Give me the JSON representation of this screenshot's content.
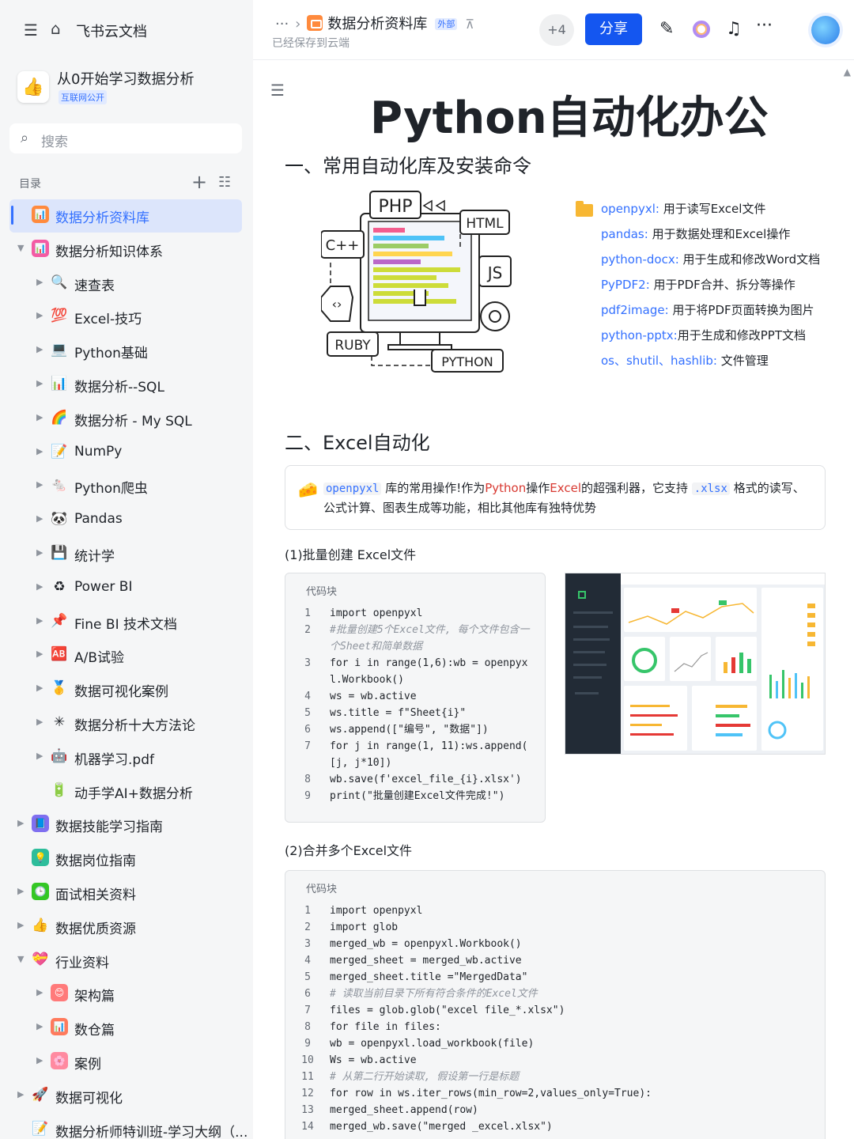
{
  "sidebar": {
    "app_name": "飞书云文档",
    "space": {
      "name": "从0开始学习数据分析",
      "badge": "互联网公开"
    },
    "search_placeholder": "搜索",
    "toc_label": "目录",
    "items": [
      {
        "label": "数据分析资料库",
        "level": 0,
        "icon": "📊",
        "icon_color": "#ff8a3d",
        "arrow": "",
        "selected": true
      },
      {
        "label": "数据分析知识体系",
        "level": 0,
        "icon": "📊",
        "icon_color": "#f45ba4",
        "arrow": "▼"
      },
      {
        "label": "速查表",
        "level": 1,
        "icon": "🔍",
        "arrow": "▶"
      },
      {
        "label": "Excel-技巧",
        "level": 1,
        "icon": "💯",
        "arrow": "▶"
      },
      {
        "label": "Python基础",
        "level": 1,
        "icon": "💻",
        "arrow": "▶"
      },
      {
        "label": "数据分析--SQL",
        "level": 1,
        "icon": "📊",
        "arrow": "▶"
      },
      {
        "label": "数据分析 - My SQL",
        "level": 1,
        "icon": "🌈",
        "arrow": "▶"
      },
      {
        "label": "NumPy",
        "level": 1,
        "icon": "📝",
        "arrow": "▶"
      },
      {
        "label": "Python爬虫",
        "level": 1,
        "icon": "🐁",
        "arrow": "▶"
      },
      {
        "label": "Pandas",
        "level": 1,
        "icon": "🐼",
        "arrow": "▶"
      },
      {
        "label": "统计学",
        "level": 1,
        "icon": "💾",
        "arrow": "▶"
      },
      {
        "label": "Power BI",
        "level": 1,
        "icon": "♻",
        "arrow": "▶"
      },
      {
        "label": "Fine BI 技术文档",
        "level": 1,
        "icon": "📌",
        "arrow": "▶"
      },
      {
        "label": "A/B试验",
        "level": 1,
        "icon": "🆎",
        "arrow": "▶"
      },
      {
        "label": "数据可视化案例",
        "level": 1,
        "icon": "🥇",
        "arrow": "▶"
      },
      {
        "label": "数据分析十大方法论",
        "level": 1,
        "icon": "✳",
        "arrow": "▶"
      },
      {
        "label": "机器学习.pdf",
        "level": 1,
        "icon": "🤖",
        "arrow": "▶"
      },
      {
        "label": "动手学AI+数据分析",
        "level": 1,
        "icon": "🔋",
        "arrow": ""
      },
      {
        "label": "数据技能学习指南",
        "level": 0,
        "icon": "📘",
        "icon_color": "#7f6ff0",
        "arrow": "▶"
      },
      {
        "label": "数据岗位指南",
        "level": 0,
        "icon": "💡",
        "icon_color": "#2dbd9b",
        "arrow": ""
      },
      {
        "label": "面试相关资料",
        "level": 0,
        "icon": "🕒",
        "icon_color": "#34c724",
        "arrow": "▶"
      },
      {
        "label": "数据优质资源",
        "level": 0,
        "icon": "👍",
        "arrow": "▶"
      },
      {
        "label": "行业资料",
        "level": 0,
        "icon": "💝",
        "arrow": "▼"
      },
      {
        "label": "架构篇",
        "level": 1,
        "icon": "😊",
        "icon_color": "#ff7a7a",
        "arrow": "▶"
      },
      {
        "label": "数仓篇",
        "level": 1,
        "icon": "📊",
        "icon_color": "#ff7a5c",
        "arrow": "▶"
      },
      {
        "label": "案例",
        "level": 1,
        "icon": "🌸",
        "icon_color": "#ff8aa0",
        "arrow": "▶"
      },
      {
        "label": "数据可视化",
        "level": 0,
        "icon": "🚀",
        "arrow": "▶"
      },
      {
        "label": "数据分析师特训班-学习大纲（...",
        "level": 0,
        "icon": "📝",
        "arrow": ""
      }
    ]
  },
  "header": {
    "breadcrumb_more": "···",
    "doc_name": "数据分析资料库",
    "external_badge": "外部",
    "saved_text": "已经保存到云端",
    "collaborators": "+4",
    "share_label": "分享",
    "more": "···"
  },
  "doc": {
    "title": "Python自动化办公",
    "section1": "一、常用自动化库及安装命令",
    "illustration_labels": {
      "php": "PHP",
      "html": "HTML",
      "cpp": "C++",
      "js": "JS",
      "ruby": "RUBY",
      "python": "PYTHON"
    },
    "libs": [
      {
        "name": "openpyxl:",
        "desc": " 用于读写Excel文件"
      },
      {
        "name": "pandas:",
        "desc": " 用于数据处理和Excel操作"
      },
      {
        "name": "python-docx:",
        "desc": " 用于生成和修改Word文档"
      },
      {
        "name": "PyPDF2:",
        "desc": " 用于PDF合并、拆分等操作"
      },
      {
        "name": "pdf2image:",
        "desc": " 用于将PDF页面转换为图片"
      },
      {
        "name": "python-pptx:",
        "desc": "用于生成和修改PPT文档"
      },
      {
        "name": "os、shutil、hashlib:",
        "desc": " 文件管理"
      }
    ],
    "section2": "二、Excel自动化",
    "callout": {
      "code1": "openpyxl",
      "text1": " 库的常用操作!作为",
      "red1": "Python",
      "text2": "操作",
      "red2": "Excel",
      "text3": "的超强利器，它支持 ",
      "code2": ".xlsx",
      "text4": " 格式的读写、公式计算、图表生成等功能，相比其他库有独特优势"
    },
    "sub1": "(1)批量创建 Excel文件",
    "code_label": "代码块",
    "code1": [
      {
        "n": "1",
        "t": "import openpyxl"
      },
      {
        "n": "2",
        "t": "#批量创建5个Excel文件, 每个文件包含一个Sheet和简单数据",
        "cm": true
      },
      {
        "n": "3",
        "t": "for i in range(1,6):wb = openpyxl.Workbook()"
      },
      {
        "n": "4",
        "t": "ws = wb.active"
      },
      {
        "n": "5",
        "t": "ws.title = f\"Sheet{i}\""
      },
      {
        "n": "6",
        "t": "ws.append([\"编号\", \"数据\"])"
      },
      {
        "n": "7",
        "t": "for j in range(1, 11):ws.append( [j, j*10])"
      },
      {
        "n": "8",
        "t": "wb.save(f'excel_file_{i}.xlsx')"
      },
      {
        "n": "9",
        "t": "print(\"批量创建Excel文件完成!\")"
      }
    ],
    "sub2": "(2)合并多个Excel文件",
    "code2": [
      {
        "n": "1",
        "t": "import openpyxl"
      },
      {
        "n": "2",
        "t": "import glob"
      },
      {
        "n": "3",
        "t": "merged_wb = openpyxl.Workbook()"
      },
      {
        "n": "4",
        "t": "merged_sheet = merged_wb.active"
      },
      {
        "n": "5",
        "t": "merged_sheet.title =\"MergedData\""
      },
      {
        "n": "6",
        "t": "# 读取当前目录下所有符合条件的Excel文件",
        "cm": true
      },
      {
        "n": "7",
        "t": "files = glob.glob(\"excel file_*.xlsx\")"
      },
      {
        "n": "8",
        "t": "for file in files:"
      },
      {
        "n": "9",
        "t": "wb = openpyxl.load_workbook(file)"
      },
      {
        "n": "10",
        "t": "Ws = wb.active"
      },
      {
        "n": "11",
        "t": "# 从第二行开始读取, 假设第一行是标题",
        "cm": true
      },
      {
        "n": "12",
        "t": "for row in ws.iter_rows(min_row=2,values_only=True):"
      },
      {
        "n": "13",
        "t": "merged_sheet.append(row)"
      },
      {
        "n": "14",
        "t": "merged_wb.save(\"merged _excel.xlsx\")"
      }
    ]
  },
  "colors": {
    "accent": "#3370ff",
    "share_bg": "#1456f0",
    "selected_bg": "#dce5fb"
  }
}
